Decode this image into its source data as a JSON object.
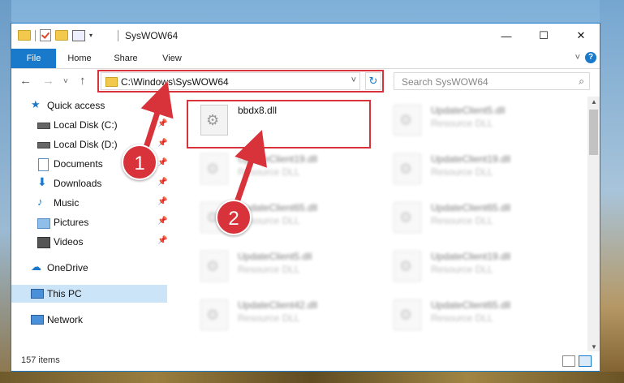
{
  "window": {
    "title": "SysWOW64"
  },
  "ribbon": {
    "tabs": [
      "File",
      "Home",
      "Share",
      "View"
    ]
  },
  "address": {
    "path": "C:\\Windows\\SysWOW64"
  },
  "search": {
    "placeholder": "Search SysWOW64"
  },
  "sidebar": {
    "items": [
      {
        "label": "Quick access",
        "icon": "star-icon"
      },
      {
        "label": "Local Disk (C:)",
        "icon": "drive-icon"
      },
      {
        "label": "Local Disk (D:)",
        "icon": "drive-icon"
      },
      {
        "label": "Documents",
        "icon": "documents-icon"
      },
      {
        "label": "Downloads",
        "icon": "download-icon"
      },
      {
        "label": "Music",
        "icon": "music-icon"
      },
      {
        "label": "Pictures",
        "icon": "pictures-icon"
      },
      {
        "label": "Videos",
        "icon": "videos-icon"
      },
      {
        "label": "OneDrive",
        "icon": "cloud-icon"
      },
      {
        "label": "This PC",
        "icon": "computer-icon"
      },
      {
        "label": "Network",
        "icon": "network-icon"
      }
    ]
  },
  "files": [
    {
      "name": "bbdx8.dll",
      "type": ""
    },
    {
      "name": "UpdateClient5.dll",
      "type": "Resource DLL"
    },
    {
      "name": "UpdateClient19.dll",
      "type": "Resource DLL"
    },
    {
      "name": "UpdateClient19.dll",
      "type": "Resource DLL"
    },
    {
      "name": "UpdateClient65.dll",
      "type": "Resource DLL"
    },
    {
      "name": "UpdateClient65.dll",
      "type": "Resource DLL"
    },
    {
      "name": "UpdateClient5.dll",
      "type": "Resource DLL"
    },
    {
      "name": "UpdateClient19.dll",
      "type": "Resource DLL"
    },
    {
      "name": "UpdateClient42.dll",
      "type": "Resource DLL"
    },
    {
      "name": "UpdateClient65.dll",
      "type": "Resource DLL"
    }
  ],
  "status": {
    "count": "157 items"
  },
  "annotations": {
    "step1": "1",
    "step2": "2"
  },
  "colors": {
    "accent": "#1979ca",
    "highlight": "#d8333b"
  }
}
